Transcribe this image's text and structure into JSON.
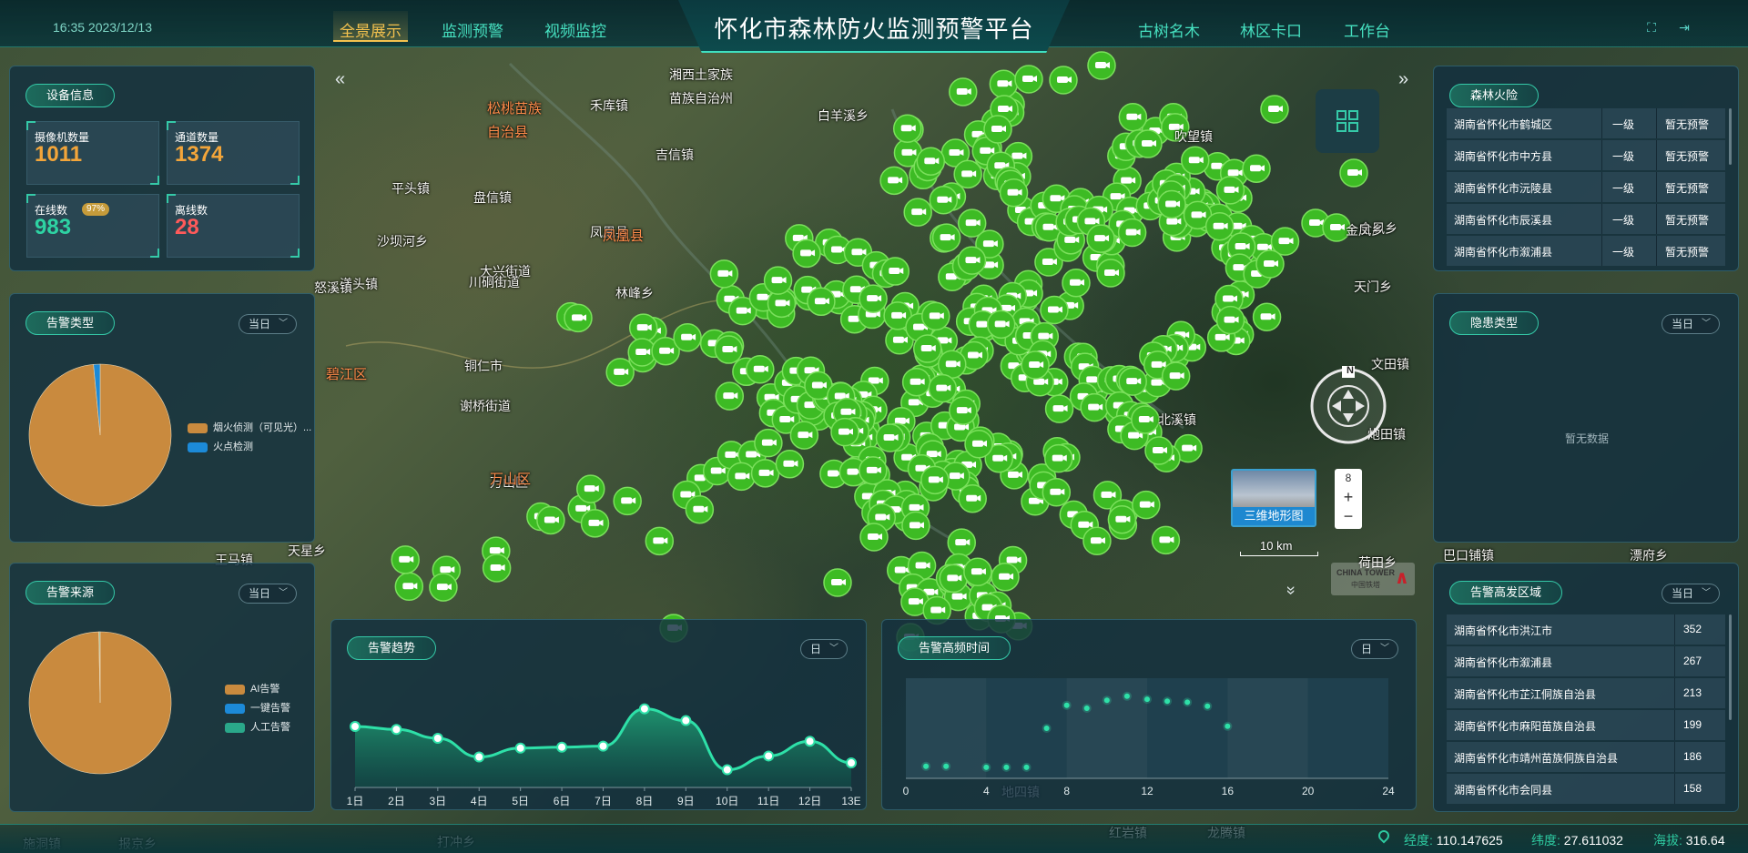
{
  "header": {
    "clock": "16:35  2023/12/13",
    "title": "怀化市森林防火监测预警平台",
    "nav_left": [
      "全景展示",
      "监测预警",
      "视频监控"
    ],
    "nav_right": [
      "古树名木",
      "林区卡口",
      "工作台"
    ],
    "active_nav": "全景展示",
    "icons": [
      "fullscreen-icon",
      "logout-icon"
    ]
  },
  "map": {
    "places": [
      "湘西土家族",
      "苗族自治州",
      "白羊溪乡",
      "吉信镇",
      "禾库镇",
      "平头镇",
      "盘信镇",
      "凤凰县",
      "大兴街道",
      "川硐街道",
      "铜仁市",
      "谢桥街道",
      "万山区",
      "林峰乡",
      "天门乡",
      "文田镇",
      "全凤乡",
      "金凤乡",
      "炮田镇",
      "沙坝河乡",
      "漾头镇",
      "怒溪镇",
      "天星乡",
      "王马镇",
      "荷田乡",
      "北溪镇",
      "地四镇",
      "吹望镇",
      "打冲乡",
      "报京乡",
      "施洞镇",
      "红岩镇",
      "龙腾镇",
      "巴口铺镇",
      "漂府乡"
    ],
    "places_red": [
      "松桃苗族",
      "自治县",
      "凤凰县",
      "碧江区",
      "万山区"
    ],
    "terrain_label": "三维地形图",
    "zoom_level": "8",
    "zoom_in": "+",
    "zoom_out": "−",
    "scale": "10 km",
    "compass_n": "N",
    "brand": "CHINA TOWER",
    "brand_sub": "中国铁塔"
  },
  "device_info": {
    "title": "设备信息",
    "camera_count_label": "摄像机数量",
    "camera_count": "1011",
    "channel_count_label": "通道数量",
    "channel_count": "1374",
    "online_label": "在线数",
    "online_badge": "97%",
    "online_count": "983",
    "offline_label": "离线数",
    "offline_count": "28",
    "colors": {
      "orange": "#f2a53a",
      "green": "#2ed3a3",
      "red": "#ff5a5a"
    }
  },
  "alarm_type": {
    "title": "告警类型",
    "filter": "当日",
    "legend": [
      "烟火侦测（可见光）...",
      "火点检测"
    ],
    "chart_data": {
      "type": "pie",
      "labels": [
        "烟火侦测（可见光）...",
        "火点检测"
      ],
      "values": [
        98.5,
        1.5
      ],
      "colors": [
        "#c98a3e",
        "#1c8ad8"
      ]
    }
  },
  "alarm_source": {
    "title": "告警来源",
    "filter": "当日",
    "legend": [
      "AI告警",
      "一键告警",
      "人工告警"
    ],
    "chart_data": {
      "type": "pie",
      "labels": [
        "AI告警",
        "一键告警",
        "人工告警"
      ],
      "values": [
        99.7,
        0.1,
        0.2
      ],
      "colors": [
        "#c98a3e",
        "#1c8ad8",
        "#2aa88a"
      ]
    }
  },
  "alarm_trend": {
    "title": "告警趋势",
    "filter": "日",
    "chart_data": {
      "type": "area",
      "categories": [
        "1日",
        "2日",
        "3日",
        "4日",
        "5日",
        "6日",
        "7日",
        "8日",
        "9日",
        "10日",
        "11日",
        "12日",
        "13E"
      ],
      "values": [
        62,
        59,
        50,
        31,
        40,
        41,
        42,
        80,
        68,
        18,
        32,
        47,
        25
      ],
      "ylim": [
        0,
        100
      ]
    }
  },
  "alarm_hours": {
    "title": "告警高频时间",
    "filter": "日",
    "chart_data": {
      "type": "scatter",
      "x": [
        1,
        2,
        4,
        5,
        6,
        7,
        8,
        9,
        10,
        11,
        12,
        13,
        14,
        15,
        16
      ],
      "y": [
        12,
        12,
        11,
        11,
        11,
        50,
        73,
        70,
        78,
        82,
        79,
        77,
        76,
        72,
        52
      ],
      "xticks": [
        "0",
        "4",
        "8",
        "12",
        "16",
        "20",
        "24"
      ],
      "xlim": [
        0,
        24
      ],
      "ylim": [
        0,
        100
      ]
    }
  },
  "forest_fire": {
    "title": "森林火险",
    "rows": [
      {
        "region": "湖南省怀化市鹤城区",
        "level": "一级",
        "status": "暂无预警"
      },
      {
        "region": "湖南省怀化市中方县",
        "level": "一级",
        "status": "暂无预警"
      },
      {
        "region": "湖南省怀化市沅陵县",
        "level": "一级",
        "status": "暂无预警"
      },
      {
        "region": "湖南省怀化市辰溪县",
        "level": "一级",
        "status": "暂无预警"
      },
      {
        "region": "湖南省怀化市溆浦县",
        "level": "一级",
        "status": "暂无预警"
      }
    ]
  },
  "hazard_type": {
    "title": "隐患类型",
    "filter": "当日",
    "empty": "暂无数据"
  },
  "hot_regions": {
    "title": "告警高发区域",
    "filter": "当日",
    "rows": [
      {
        "region": "湖南省怀化市洪江市",
        "count": "352"
      },
      {
        "region": "湖南省怀化市溆浦县",
        "count": "267"
      },
      {
        "region": "湖南省怀化市芷江侗族自治县",
        "count": "213"
      },
      {
        "region": "湖南省怀化市麻阳苗族自治县",
        "count": "199"
      },
      {
        "region": "湖南省怀化市靖州苗族侗族自治县",
        "count": "186"
      },
      {
        "region": "湖南省怀化市会同县",
        "count": "158"
      }
    ]
  },
  "status_bar": {
    "lon_label": "经度:",
    "lon": "110.147625",
    "lat_label": "纬度:",
    "lat": "27.611032",
    "alt_label": "海拔:",
    "alt": "316.64"
  }
}
